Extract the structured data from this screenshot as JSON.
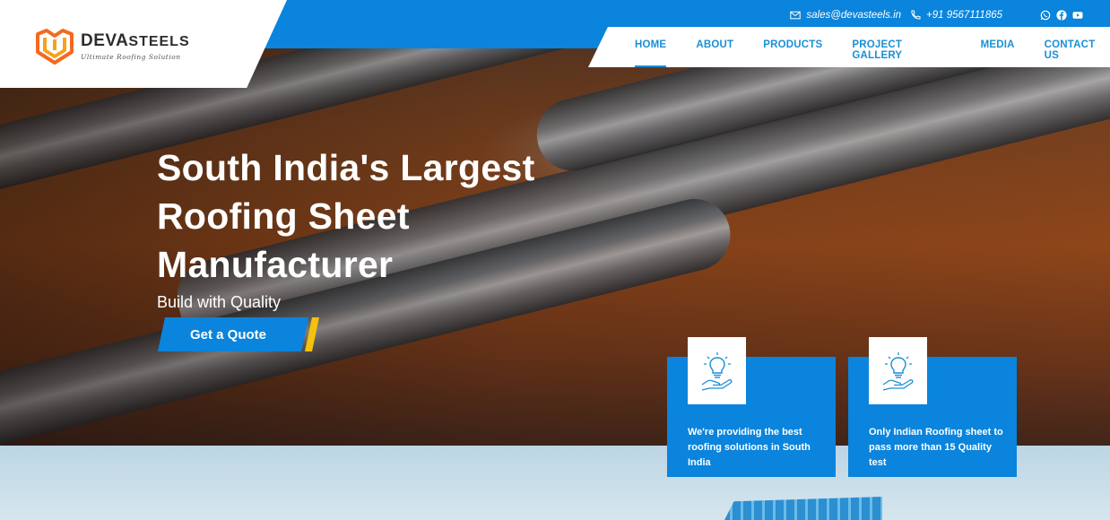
{
  "brand": {
    "name_part1": "DEVA",
    "name_part2": "STEELS",
    "tagline": "Ultimate Roofing Solution"
  },
  "contact": {
    "email": "sales@devasteels.in",
    "phone": "+91 9567111865"
  },
  "social": [
    "whatsapp-icon",
    "facebook-icon",
    "youtube-icon"
  ],
  "nav": {
    "items": [
      {
        "label": "HOME",
        "active": true
      },
      {
        "label": "ABOUT"
      },
      {
        "label": "PRODUCTS"
      },
      {
        "label": "PROJECT GALLERY"
      },
      {
        "label": "MEDIA"
      },
      {
        "label": "CONTACT US"
      }
    ]
  },
  "hero": {
    "headline_line1": "South India's Largest",
    "headline_line2": "Roofing Sheet",
    "headline_line3": "Manufacturer",
    "subtitle": "Build with Quality",
    "cta": "Get a Quote"
  },
  "cards": [
    {
      "icon": "idea-hand-icon",
      "text": "We're providing the best roofing solutions in South India"
    },
    {
      "icon": "idea-hand-icon",
      "text": "Only Indian Roofing sheet to pass more than 15 Quality test"
    }
  ],
  "colors": {
    "brand_blue": "#0a84dc",
    "accent_yellow": "#f4c20d"
  }
}
